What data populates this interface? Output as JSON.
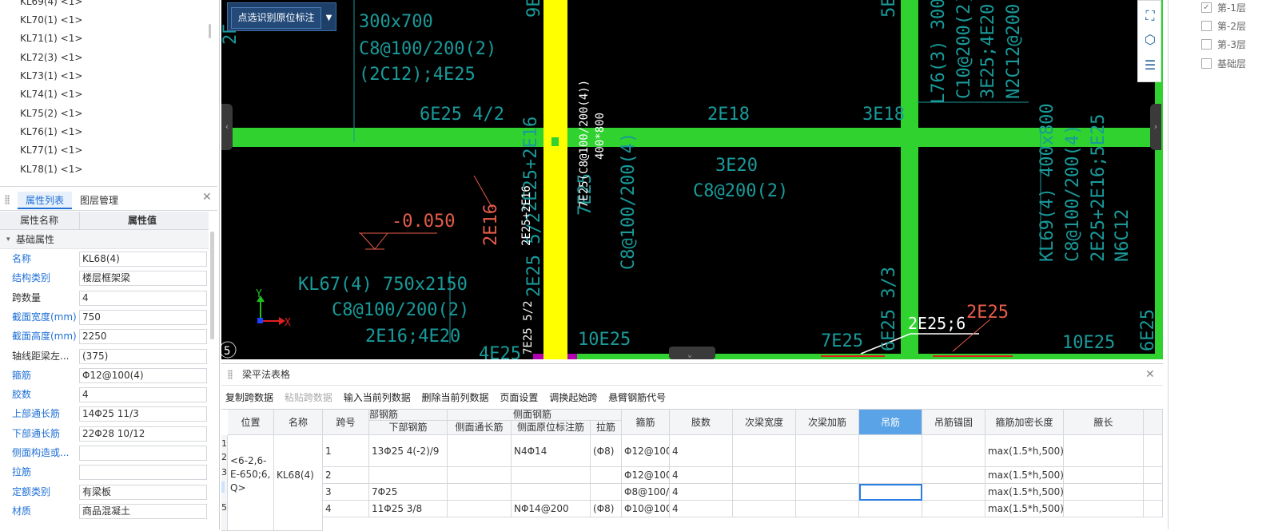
{
  "tree": {
    "items": [
      "KL69(4) <1>",
      "KL70(1) <1>",
      "KL71(1) <1>",
      "KL72(3) <1>",
      "KL73(1) <1>",
      "KL74(1) <1>",
      "KL75(2) <1>",
      "KL76(1) <1>",
      "KL77(1) <1>",
      "KL78(1) <1>"
    ]
  },
  "props_panel": {
    "tab_properties": "属性列表",
    "tab_layers": "图层管理",
    "col_name": "属性名称",
    "col_value": "属性值",
    "group": "基础属性",
    "rows": [
      {
        "k": "名称",
        "v": "KL68(4)"
      },
      {
        "k": "结构类别",
        "v": "楼层框架梁"
      },
      {
        "k": "跨数量",
        "v": "4"
      },
      {
        "k": "截面宽度(mm)",
        "v": "750"
      },
      {
        "k": "截面高度(mm)",
        "v": "2250"
      },
      {
        "k": "轴线距梁左...",
        "v": "(375)"
      },
      {
        "k": "箍筋",
        "v": "Φ12@100(4)"
      },
      {
        "k": "胶数",
        "v": "4"
      },
      {
        "k": "上部通长筋",
        "v": "14Φ25 11/3"
      },
      {
        "k": "下部通长筋",
        "v": "22Φ28 10/12"
      },
      {
        "k": "侧面构造或...",
        "v": ""
      },
      {
        "k": "拉筋",
        "v": ""
      },
      {
        "k": "定额类别",
        "v": "有梁板"
      },
      {
        "k": "材质",
        "v": "商品混凝土"
      }
    ]
  },
  "cad": {
    "button_label": "点选识别原位标注",
    "axis_x": "X",
    "axis_y": "Y",
    "marker_5": "5",
    "texts": {
      "t1": "300x700",
      "t2": "C8@100/200(2)",
      "t3": "(2C12);4E25",
      "t4": "6E25 4/2",
      "t5": "2E18",
      "t6": "3E18",
      "t7": "3E20",
      "t8": "C8@200(2)",
      "t9": "-0.050",
      "t10": "2E16",
      "t11": "KL67(4) 750x2150",
      "t12": "C8@100/200(2)",
      "t13": "2E16;4E20",
      "t14": "4E25",
      "t15": "10E25",
      "t16": "7E25",
      "t17": "2E25;6",
      "t18": "2E25",
      "t19": "10E25",
      "t20": "6E25",
      "v1": "L76(3) 300x",
      "v2": "C10@200(2)",
      "v3": "3E25;4E20",
      "v4": "N2C12@200",
      "v5": "KL69(4) 400x800",
      "v6": "C8@100/200(4)",
      "v7": "2E25+2E16;5E25",
      "v8": "N6C12",
      "v9": "7E25(C8@100/200(4))",
      "v10": "400*800",
      "v11": "7E25",
      "v12": "C8@100/200(4)",
      "v13": "2E25+2E16",
      "v14": "2E25 5/2",
      "v15": "7E25 5/2",
      "v16": "6E25 3/3",
      "v17": "5E",
      "v18": "9E",
      "v19": "2E"
    }
  },
  "bottom": {
    "title": "梁平法表格",
    "toolbar": [
      "复制跨数据",
      "粘贴跨数据",
      "输入当前列数据",
      "删除当前列数据",
      "页面设置",
      "调换起始跨",
      "悬臂钢筋代号"
    ],
    "headers": {
      "pos": "位置",
      "name": "名称",
      "span": "跨号",
      "group_bottom": "部钢筋",
      "bottom": "下部钢筋",
      "group_side": "侧面钢筋",
      "side_long": "侧面通长筋",
      "side_orig": "侧面原位标注筋",
      "tie": "拉筋",
      "stirrup": "箍筋",
      "legs": "肢数",
      "sec_width": "次梁宽度",
      "sec_add": "次梁加筋",
      "hanger": "吊筋",
      "hanger_anchor": "吊筋锚固",
      "stir_dense": "箍筋加密长度",
      "haunch": "腋长"
    },
    "row_numbers": [
      "1",
      "2",
      "3",
      "4",
      "5"
    ],
    "position_cell": "<6-2,6-E-650;6,Q>",
    "name_cell": "KL68(4)",
    "rows": [
      {
        "span": "1",
        "bottom": "13Φ25 4(-2)/9",
        "side_long": "",
        "side_orig": "N4Φ14",
        "tie": "(Φ8)",
        "stirrup": "Φ12@100",
        "legs": "4",
        "dense": "max(1.5*h,500)"
      },
      {
        "span": "2",
        "bottom": "",
        "side_long": "",
        "side_orig": "",
        "tie": "",
        "stirrup": "Φ12@100",
        "legs": "4",
        "dense": "max(1.5*h,500)"
      },
      {
        "span": "3",
        "bottom": "7Φ25",
        "side_long": "",
        "side_orig": "",
        "tie": "",
        "stirrup": "Φ8@100/",
        "legs": "4",
        "dense": "max(1.5*h,500)"
      },
      {
        "span": "4",
        "bottom": "11Φ25 3/8",
        "side_long": "",
        "side_orig": "NΦ14@200",
        "tie": "(Φ8)",
        "stirrup": "Φ10@100",
        "legs": "4",
        "dense": "max(1.5*h,500)"
      }
    ]
  },
  "layers": {
    "items": [
      {
        "label": "第-1层",
        "checked": true
      },
      {
        "label": "第-2层",
        "checked": false
      },
      {
        "label": "第-3层",
        "checked": false
      },
      {
        "label": "基础层",
        "checked": false
      }
    ]
  },
  "colors": {
    "accent": "#1f6fd6",
    "cad_green": "#2fd22f",
    "cad_yellow": "#ffff00",
    "cad_text": "#1a9a9a",
    "cad_red": "#e85c4a",
    "header_blue": "#5aa3e6"
  }
}
